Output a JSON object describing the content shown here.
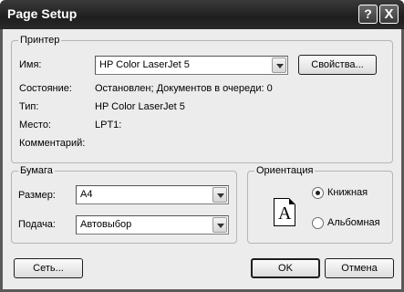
{
  "window": {
    "title": "Page Setup",
    "help_glyph": "?",
    "close_glyph": "X"
  },
  "printer": {
    "legend": "Принтер",
    "name_label": "Имя:",
    "name_value": "HP Color LaserJet 5",
    "properties_button": "Свойства...",
    "status_label": "Состояние:",
    "status_value": "Остановлен; Документов в очереди: 0",
    "type_label": "Тип:",
    "type_value": "HP Color LaserJet 5",
    "where_label": "Место:",
    "where_value": "LPT1:",
    "comment_label": "Комментарий:",
    "comment_value": ""
  },
  "paper": {
    "legend": "Бумага",
    "size_label": "Размер:",
    "size_value": "A4",
    "source_label": "Подача:",
    "source_value": "Автовыбор"
  },
  "orientation": {
    "legend": "Ориентация",
    "preview_letter": "A",
    "portrait_label": "Книжная",
    "landscape_label": "Альбомная",
    "selected": "portrait"
  },
  "buttons": {
    "network": "Сеть...",
    "ok": "OK",
    "cancel": "Отмена"
  }
}
